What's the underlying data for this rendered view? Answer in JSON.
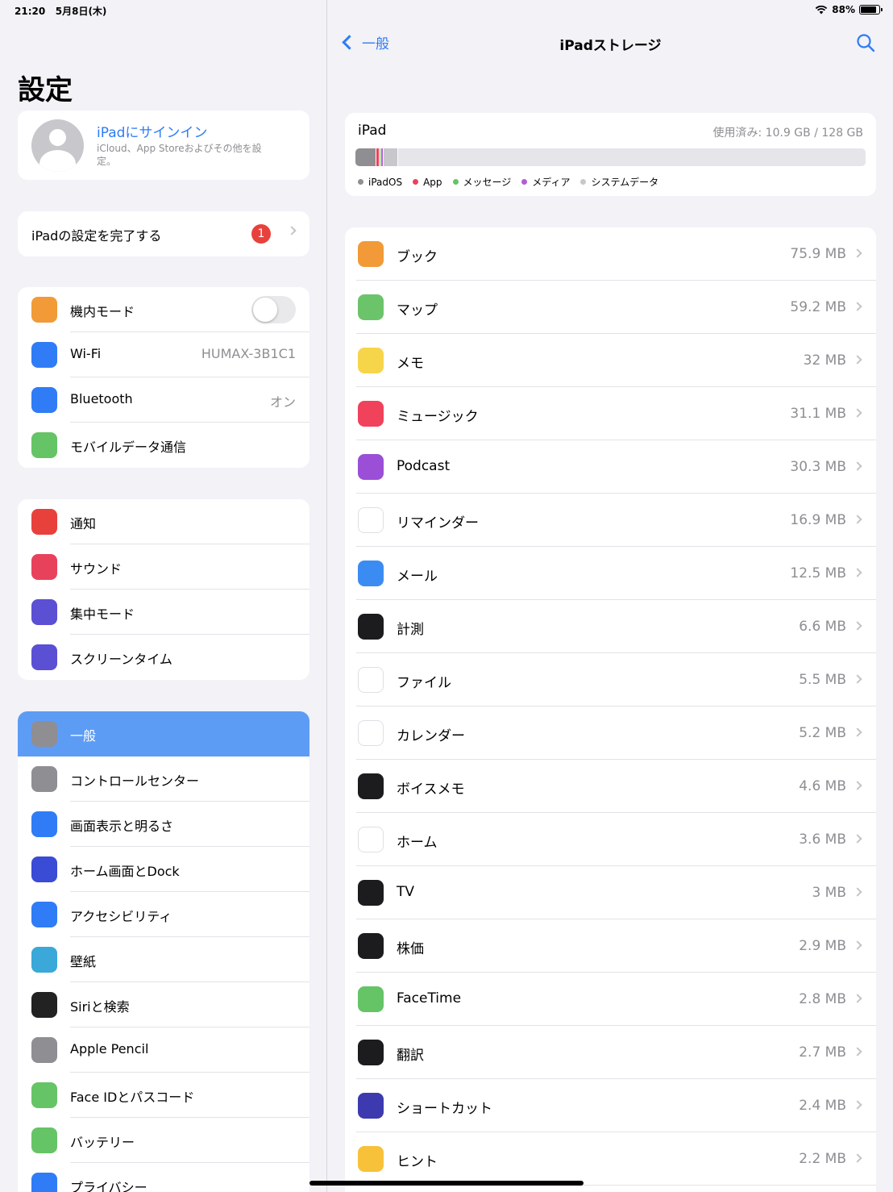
{
  "status": {
    "time": "21:20",
    "date": "5月8日(木)",
    "battery": "88%",
    "battery_level": 0.88
  },
  "sidebar": {
    "title": "設定",
    "profile": {
      "name": "iPadにサインイン",
      "subtitle": "iCloud、App Storeおよびその他を設定。"
    },
    "setup": {
      "label": "iPadの設定を完了する",
      "badge": "1"
    },
    "group1": [
      {
        "label": "機内モード",
        "icon": "airplane-icon",
        "color": "#f19a37",
        "toggle": false
      },
      {
        "label": "Wi-Fi",
        "icon": "wifi-icon",
        "color": "#2f7cf6",
        "value": "HUMAX-3B1C1"
      },
      {
        "label": "Bluetooth",
        "icon": "bluetooth-icon",
        "color": "#2f7cf6",
        "value": "オン"
      },
      {
        "label": "モバイルデータ通信",
        "icon": "antenna-icon",
        "color": "#65c466"
      }
    ],
    "group2": [
      {
        "label": "通知",
        "icon": "bell-icon",
        "color": "#e8413c"
      },
      {
        "label": "サウンド",
        "icon": "speaker-icon",
        "color": "#e8415b"
      },
      {
        "label": "集中モード",
        "icon": "moon-icon",
        "color": "#5b4fd4"
      },
      {
        "label": "スクリーンタイム",
        "icon": "hourglass-icon",
        "color": "#5b4fd4"
      }
    ],
    "group3": [
      {
        "label": "一般",
        "icon": "gear-icon",
        "color": "#8e8e93",
        "selected": true
      },
      {
        "label": "コントロールセンター",
        "icon": "toggles-icon",
        "color": "#8e8e93"
      },
      {
        "label": "画面表示と明るさ",
        "icon": "text-size-icon",
        "color": "#2f7cf6"
      },
      {
        "label": "ホーム画面とDock",
        "icon": "grid-icon",
        "color": "#3a4bd6"
      },
      {
        "label": "アクセシビリティ",
        "icon": "accessibility-icon",
        "color": "#2f7cf6"
      },
      {
        "label": "壁紙",
        "icon": "flower-icon",
        "color": "#3aa8d8"
      },
      {
        "label": "Siriと検索",
        "icon": "siri-icon",
        "color": "#222222"
      },
      {
        "label": "Apple Pencil",
        "icon": "pencil-icon",
        "color": "#8e8e93"
      },
      {
        "label": "Face IDとパスコード",
        "icon": "faceid-icon",
        "color": "#65c466"
      },
      {
        "label": "バッテリー",
        "icon": "battery-icon",
        "color": "#65c466"
      },
      {
        "label": "プライバシー",
        "icon": "hand-icon",
        "color": "#2f7cf6"
      }
    ]
  },
  "main": {
    "back_label": "一般",
    "title": "iPadストレージ",
    "storage": {
      "device": "iPad",
      "used": "使用済み: 10.9 GB / 128 GB",
      "segments": [
        {
          "name": "iPadOS",
          "color": "#8e8e93",
          "fraction": 0.041
        },
        {
          "name": "App",
          "color": "#e8415b",
          "fraction": 0.006
        },
        {
          "name": "メッセージ",
          "color": "#65c466",
          "fraction": 0.004
        },
        {
          "name": "メディア",
          "color": "#b35bd6",
          "fraction": 0.005
        },
        {
          "name": "システムデータ",
          "color": "#c7c7cc",
          "fraction": 0.027
        }
      ]
    },
    "apps": [
      {
        "name": "ブック",
        "size": "75.9 MB",
        "icon": "books-icon",
        "color": "#f19a37"
      },
      {
        "name": "マップ",
        "size": "59.2 MB",
        "icon": "maps-icon",
        "color": "#6cc46a"
      },
      {
        "name": "メモ",
        "size": "32 MB",
        "icon": "notes-icon",
        "color": "#f7d54a"
      },
      {
        "name": "ミュージック",
        "size": "31.1 MB",
        "icon": "music-icon",
        "color": "#f0425b"
      },
      {
        "name": "Podcast",
        "size": "30.3 MB",
        "icon": "podcast-icon",
        "color": "#9a4fd6"
      },
      {
        "name": "リマインダー",
        "size": "16.9 MB",
        "icon": "reminders-icon",
        "color": "#ffffff"
      },
      {
        "name": "メール",
        "size": "12.5 MB",
        "icon": "mail-icon",
        "color": "#3b8cf2"
      },
      {
        "name": "計測",
        "size": "6.6 MB",
        "icon": "measure-icon",
        "color": "#1c1c1e"
      },
      {
        "name": "ファイル",
        "size": "5.5 MB",
        "icon": "files-icon",
        "color": "#ffffff"
      },
      {
        "name": "カレンダー",
        "size": "5.2 MB",
        "icon": "calendar-icon",
        "color": "#ffffff"
      },
      {
        "name": "ボイスメモ",
        "size": "4.6 MB",
        "icon": "voice-memos-icon",
        "color": "#1c1c1e"
      },
      {
        "name": "ホーム",
        "size": "3.6 MB",
        "icon": "home-app-icon",
        "color": "#ffffff"
      },
      {
        "name": "TV",
        "size": "3 MB",
        "icon": "tv-icon",
        "color": "#1c1c1e"
      },
      {
        "name": "株価",
        "size": "2.9 MB",
        "icon": "stocks-icon",
        "color": "#1c1c1e"
      },
      {
        "name": "FaceTime",
        "size": "2.8 MB",
        "icon": "facetime-icon",
        "color": "#65c466"
      },
      {
        "name": "翻訳",
        "size": "2.7 MB",
        "icon": "translate-icon",
        "color": "#1c1c1e"
      },
      {
        "name": "ショートカット",
        "size": "2.4 MB",
        "icon": "shortcuts-icon",
        "color": "#3d3ab0"
      },
      {
        "name": "ヒント",
        "size": "2.2 MB",
        "icon": "tips-icon",
        "color": "#f7c23a"
      }
    ]
  }
}
